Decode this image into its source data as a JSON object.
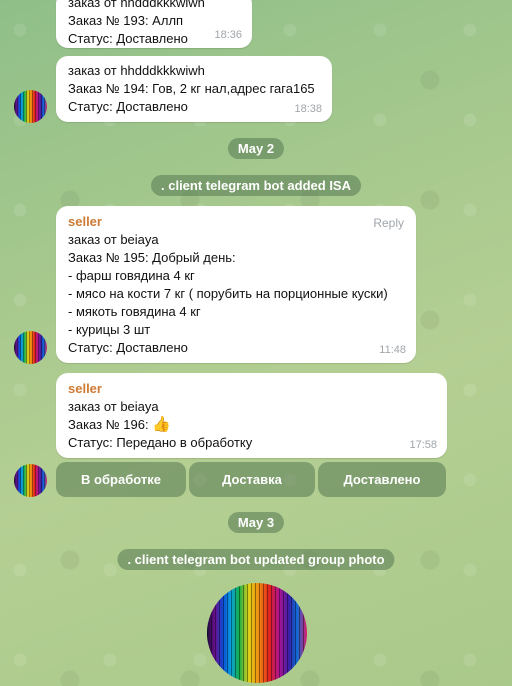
{
  "messages": [
    {
      "lines": [
        "заказ от hhdddkkkwiwh",
        "Заказ № 193: Аллп",
        "Статус: Доставлено"
      ],
      "time": "18:36"
    },
    {
      "lines": [
        "заказ от hhdddkkkwiwh",
        "Заказ № 194: Гов, 2 кг нал,адрес гага165",
        "Статус: Доставлено"
      ],
      "time": "18:38"
    },
    {
      "sender": "seller",
      "reply_label": "Reply",
      "lines": [
        "заказ от beiaya",
        "Заказ № 195: Добрый день:",
        "- фарш говядина 4 кг",
        "- мясо на кости 7 кг ( порубить на порционные куски)",
        "- мякоть говядина 4 кг",
        "- курицы 3 шт",
        "Статус: Доставлено"
      ],
      "time": "11:48"
    },
    {
      "sender": "seller",
      "lines": [
        "заказ от beiaya",
        "Заказ № 196:",
        "Статус: Передано в обработку"
      ],
      "emoji": "👍",
      "time": "17:58"
    }
  ],
  "service": {
    "date_may2": "May 2",
    "added_isa": ". client telegram bot added ISA",
    "date_may3": "May 3",
    "updated_photo": ". client telegram bot updated group photo"
  },
  "keyboard": {
    "buttons": [
      "В обработке",
      "Доставка",
      "Доставлено"
    ]
  },
  "icons": {
    "avatar": "rainbow-stripes-avatar",
    "group_photo": "rainbow-stripes-photo",
    "thumbs_up": "thumbs-up-emoji"
  }
}
